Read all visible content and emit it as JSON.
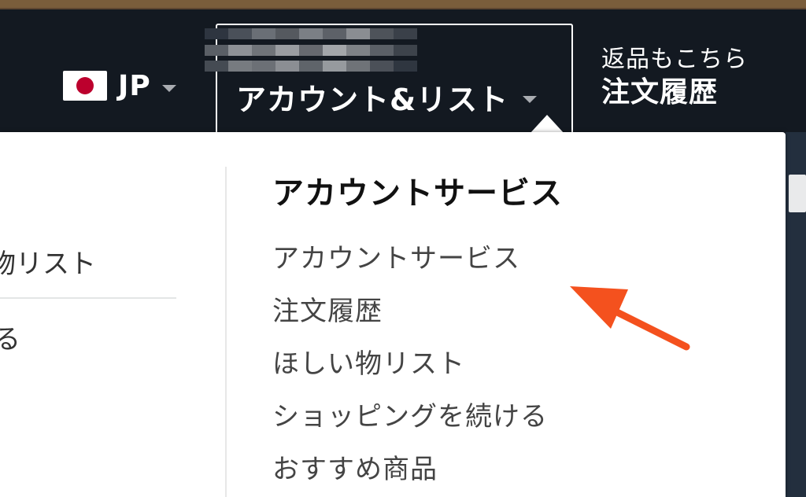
{
  "header": {
    "language": {
      "code": "JP"
    },
    "account": {
      "main_label": "アカウント&リスト"
    },
    "returns": {
      "line1": "返品もこちら",
      "line2": "注文履歴"
    }
  },
  "dropdown": {
    "left_column": {
      "items": [
        "物リスト",
        "る"
      ]
    },
    "account_services": {
      "heading": "アカウントサービス",
      "items": [
        "アカウントサービス",
        "注文履歴",
        "ほしい物リスト",
        "ショッピングを続ける",
        "おすすめ商品"
      ]
    }
  },
  "colors": {
    "nav_background": "#131921",
    "top_strip": "#7a5d3b",
    "flag_red": "#bc002d",
    "annotation_arrow": "#f4511e",
    "dropdown_background": "#ffffff"
  },
  "icons": {
    "language": "japan-flag-icon",
    "dropdown": "caret-down-icon",
    "annotation": "arrow-annotation-icon"
  }
}
